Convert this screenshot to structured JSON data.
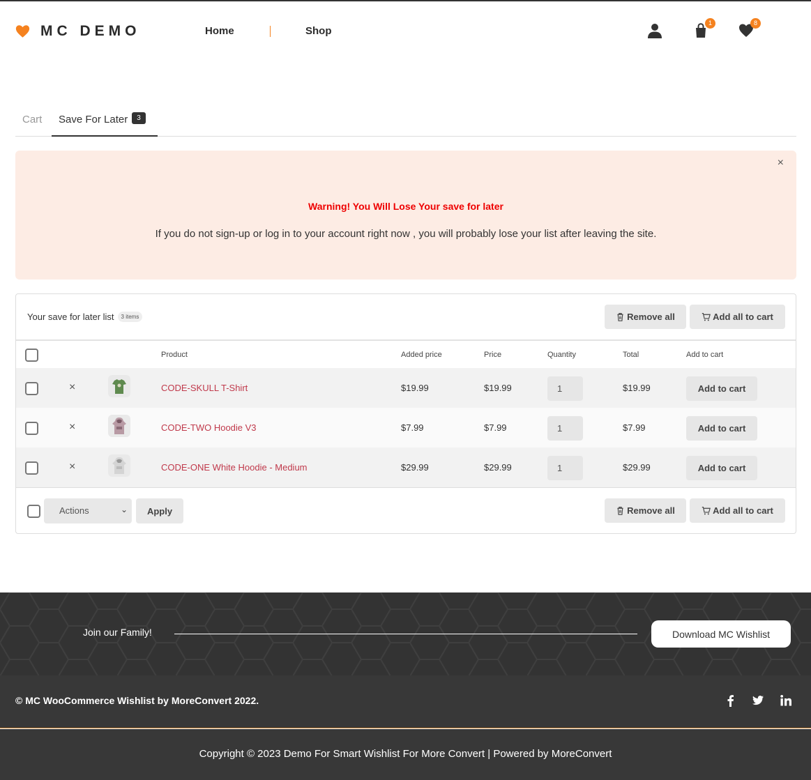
{
  "header": {
    "logo_text": "MC DEMO",
    "nav": {
      "home": "Home",
      "shop": "Shop"
    },
    "cart_count": "1",
    "wishlist_count": "8",
    "accent_color": "#f5821f"
  },
  "tabs": {
    "cart": "Cart",
    "save_for_later": "Save For Later",
    "save_for_later_count": "3"
  },
  "warning": {
    "close": "×",
    "title": "Warning! You Will Lose Your save for later",
    "text": "If you do not sign-up or log in to your account right now , you will probably lose your list after leaving the site."
  },
  "list": {
    "title": "Your save for later list",
    "items_count": "3 items",
    "remove_all": "Remove all",
    "add_all_to_cart": "Add all to cart",
    "columns": [
      "Product",
      "Added price",
      "Price",
      "Quantity",
      "Total",
      "Add to cart"
    ],
    "rows": [
      {
        "remove": "×",
        "name": "CODE-SKULL T-Shirt",
        "added_price": "$19.99",
        "price": "$19.99",
        "quantity": "1",
        "total": "$19.99",
        "add_to_cart": "Add to cart",
        "thumb": "green-tshirt"
      },
      {
        "remove": "×",
        "name": "CODE-TWO Hoodie V3",
        "added_price": "$7.99",
        "price": "$7.99",
        "quantity": "1",
        "total": "$7.99",
        "add_to_cart": "Add to cart",
        "thumb": "pink-hoodie"
      },
      {
        "remove": "×",
        "name": "CODE-ONE White Hoodie - Medium",
        "added_price": "$29.99",
        "price": "$29.99",
        "quantity": "1",
        "total": "$29.99",
        "add_to_cart": "Add to cart",
        "thumb": "white-hoodie"
      }
    ],
    "bulk_action": "Actions",
    "apply": "Apply"
  },
  "footer": {
    "join": "Join our Family!",
    "download": "Download MC Wishlist",
    "copyright_main": "© MC WooCommerce Wishlist by MoreConvert 2022.",
    "social": [
      "facebook-icon",
      "twitter-icon",
      "linkedin-icon"
    ],
    "copyright_bottom": "Copyright © 2023 Demo For Smart Wishlist For More Convert | Powered by MoreConvert"
  }
}
